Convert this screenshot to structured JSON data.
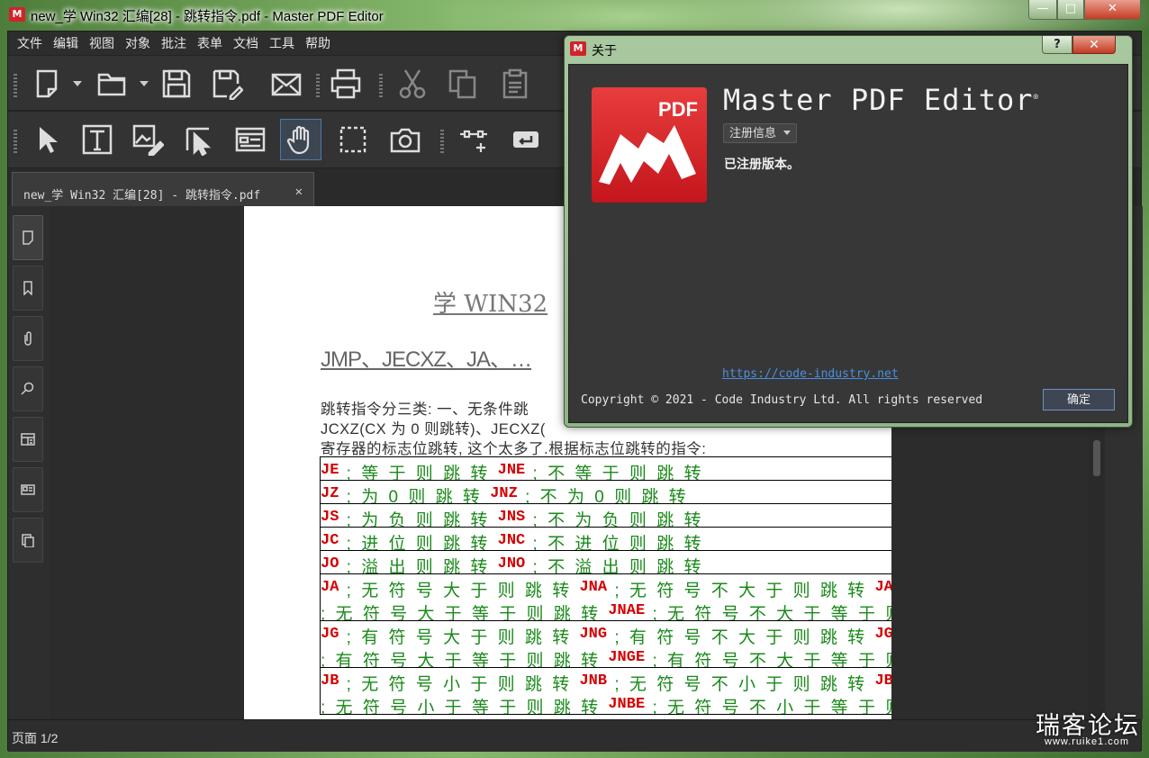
{
  "window": {
    "title": "new_学 Win32 汇编[28] - 跳转指令.pdf - Master PDF Editor",
    "logo": "M",
    "min": "—",
    "max": "□",
    "close": "✕"
  },
  "menu": [
    "文件",
    "编辑",
    "视图",
    "对象",
    "批注",
    "表单",
    "文档",
    "工具",
    "帮助"
  ],
  "toolbar1": [
    "new-document-icon",
    "open-folder-icon",
    "save-icon",
    "save-as-icon",
    "email-icon",
    "print-icon",
    "cut-icon",
    "copy-icon",
    "paste-icon"
  ],
  "toolbar2": [
    "select-arrow-icon",
    "text-edit-icon",
    "image-edit-icon",
    "object-select-icon",
    "form-icon",
    "hand-tool-icon",
    "crop-icon",
    "snapshot-icon",
    "link-icon",
    "enter-icon"
  ],
  "tab": {
    "label": "new_学 Win32 汇编[28] - 跳转指令.pdf",
    "close": "✕"
  },
  "sidebar": [
    "pages-icon",
    "bookmarks-icon",
    "attachments-icon",
    "search-icon",
    "layers-icon",
    "fields-icon",
    "duplicates-icon"
  ],
  "page": {
    "title": "学 WIN32",
    "heading": "JMP、JECXZ、JA、…",
    "paragraphs": [
      "跳转指令分三类: 一、无条件跳",
      "JCXZ(CX 为 0 则跳转)、JECXZ(",
      "寄存器的标志位跳转, 这个太多了.根据标志位跳转的指令:"
    ],
    "rows": [
      {
        "lines": [
          [
            {
              "op": "JE",
              "d": " ; 等 于 则 跳 转 "
            },
            {
              "op": "JNE",
              "d": " ; 不 等 于 则 跳 转"
            }
          ]
        ]
      },
      {
        "lines": [
          [
            {
              "op": "JZ",
              "d": " ; 为  0  则 跳 转 "
            },
            {
              "op": "JNZ",
              "d": " ; 不 为  0  则 跳 转"
            }
          ]
        ]
      },
      {
        "lines": [
          [
            {
              "op": "JS",
              "d": " ; 为 负 则 跳 转 "
            },
            {
              "op": "JNS",
              "d": " ; 不 为 负 则 跳 转"
            }
          ]
        ]
      },
      {
        "lines": [
          [
            {
              "op": "JC",
              "d": " ; 进 位 则 跳 转 "
            },
            {
              "op": "JNC",
              "d": " ; 不 进 位 则 跳 转"
            }
          ]
        ]
      },
      {
        "lines": [
          [
            {
              "op": "JO",
              "d": " ; 溢 出 则 跳 转 "
            },
            {
              "op": "JNO",
              "d": " ; 不 溢 出 则 跳 转"
            }
          ]
        ]
      },
      {
        "lines": [
          [
            {
              "op": "JA",
              "d": " ; 无 符 号 大 于 则 跳 转 "
            },
            {
              "op": "JNA",
              "d": " ; 无 符 号 不 大 于 则 跳 转 "
            },
            {
              "op": "JAE",
              "d": ""
            }
          ],
          [
            {
              "op": "",
              "d": "; 无 符 号 大 于 等 于 则 跳 转 "
            },
            {
              "op": "JNAE",
              "d": " ; 无 符 号 不 大 于 等 于 则 跳"
            }
          ]
        ]
      },
      {
        "lines": [
          [
            {
              "op": "JG",
              "d": " ; 有 符 号 大 于 则 跳 转 "
            },
            {
              "op": "JNG",
              "d": " ; 有 符 号 不 大 于 则 跳 转 "
            },
            {
              "op": "JGE",
              "d": ""
            }
          ],
          [
            {
              "op": "",
              "d": "; 有 符 号 大 于 等 于 则 跳 转 "
            },
            {
              "op": "JNGE",
              "d": " ; 有 符 号 不 大 于 等 于 则 跳"
            }
          ]
        ]
      },
      {
        "lines": [
          [
            {
              "op": "JB",
              "d": " ; 无 符 号 小 于 则 跳 转 "
            },
            {
              "op": "JNB",
              "d": " ; 无 符 号 不 小 于 则 跳 转 "
            },
            {
              "op": "JBE",
              "d": ""
            }
          ],
          [
            {
              "op": "",
              "d": "; 无 符 号 小 于 等 于 则 跳 转 "
            },
            {
              "op": "JNBE",
              "d": " ; 无 符 号 不 小 于 等 于 则 跳"
            }
          ]
        ]
      }
    ]
  },
  "status": {
    "page": "页面 1/2"
  },
  "watermark": {
    "text": "瑞客论坛",
    "url": "www.ruike1.com"
  },
  "dialog": {
    "title": "关于",
    "help": "?",
    "close": "✕",
    "logo_text": "PDF",
    "product": "Master PDF Editor",
    "reg_mark": "®",
    "reg_button": "注册信息",
    "registered": "已注册版本。",
    "link": "https://code-industry.net",
    "copyright": "Copyright © 2021 - Code Industry Ltd. All rights reserved",
    "ok": "确定"
  }
}
